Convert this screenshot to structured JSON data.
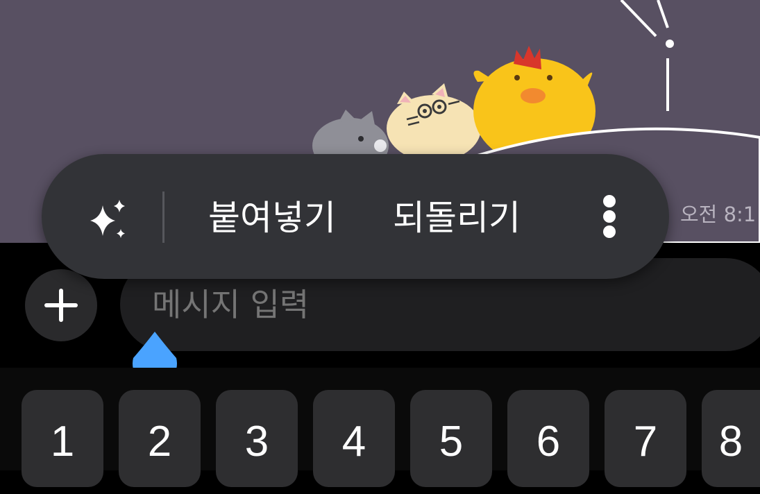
{
  "chat": {
    "timestamp": "오전 8:1"
  },
  "context_menu": {
    "ai_icon": "sparkles-icon",
    "paste_label": "붙여넣기",
    "undo_label": "되돌리기",
    "more_icon": "more-vertical-icon"
  },
  "composer": {
    "add_icon": "plus-icon",
    "placeholder": "메시지 입력"
  },
  "keyboard": {
    "number_row": [
      "1",
      "2",
      "3",
      "4",
      "5",
      "6",
      "7",
      "8"
    ]
  },
  "colors": {
    "wallpaper": "#585062",
    "menu_background": "#323337",
    "cursor_handle": "#4aa3ff",
    "key_background": "#2e2e30"
  }
}
